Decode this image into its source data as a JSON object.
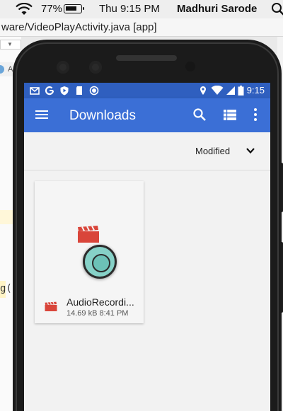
{
  "mac_menubar": {
    "battery_percent": "77%",
    "clock": "Thu 9:15 PM",
    "user": "Madhuri Sarode"
  },
  "ide": {
    "window_title": "ware/VideoPlayActivity.java [app]",
    "gutter_row_text": "A",
    "code_fragment": "g("
  },
  "android": {
    "status_time": "9:15",
    "app_title": "Downloads",
    "sort_label": "Modified",
    "files": [
      {
        "name": "AudioRecordi...",
        "size": "14.69 kB",
        "time": "8:41 PM"
      }
    ]
  },
  "colors": {
    "status_bar": "#2f5fbf",
    "app_bar": "#3b6fd6",
    "video_icon": "#d9453a",
    "touch_indicator": "#86d1c7"
  }
}
